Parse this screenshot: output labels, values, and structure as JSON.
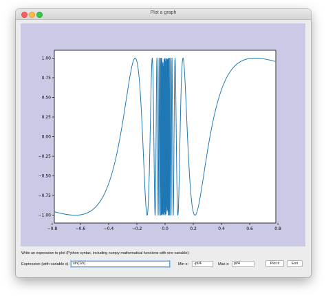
{
  "window": {
    "title": "Plot a graph"
  },
  "prompt": "Write an expression to plot (Python syntax, including numpy mathematical functions with one variable):",
  "expression": {
    "label": "Expression (with variable x):",
    "value": "sin(1/x)"
  },
  "min_x": {
    "label": "Min x:",
    "value": "-pi/4"
  },
  "max_x": {
    "label": "Max x:",
    "value": "pi/4"
  },
  "buttons": {
    "plot": "Plot it",
    "exit": "Exit"
  },
  "colors": {
    "plot_background": "#cacae6",
    "line": "#1f77b4",
    "focus_ring": "#6aa0e6"
  },
  "chart_data": {
    "type": "line",
    "function": "sin(1/x)",
    "xlim": [
      -0.785,
      0.785
    ],
    "ylim": [
      -1.1,
      1.1
    ],
    "xticks": [
      "−0.8",
      "−0.6",
      "−0.4",
      "−0.2",
      "0.0",
      "0.2",
      "0.4",
      "0.6",
      "0.8"
    ],
    "xtick_values": [
      -0.8,
      -0.6,
      -0.4,
      -0.2,
      0.0,
      0.2,
      0.4,
      0.6,
      0.8
    ],
    "yticks": [
      "−1.00",
      "−0.75",
      "−0.50",
      "−0.25",
      "0.00",
      "0.25",
      "0.50",
      "0.75",
      "1.00"
    ],
    "ytick_values": [
      -1.0,
      -0.75,
      -0.5,
      -0.25,
      0.0,
      0.25,
      0.5,
      0.75,
      1.0
    ],
    "series": [
      {
        "color": "#1f77b4"
      }
    ]
  }
}
